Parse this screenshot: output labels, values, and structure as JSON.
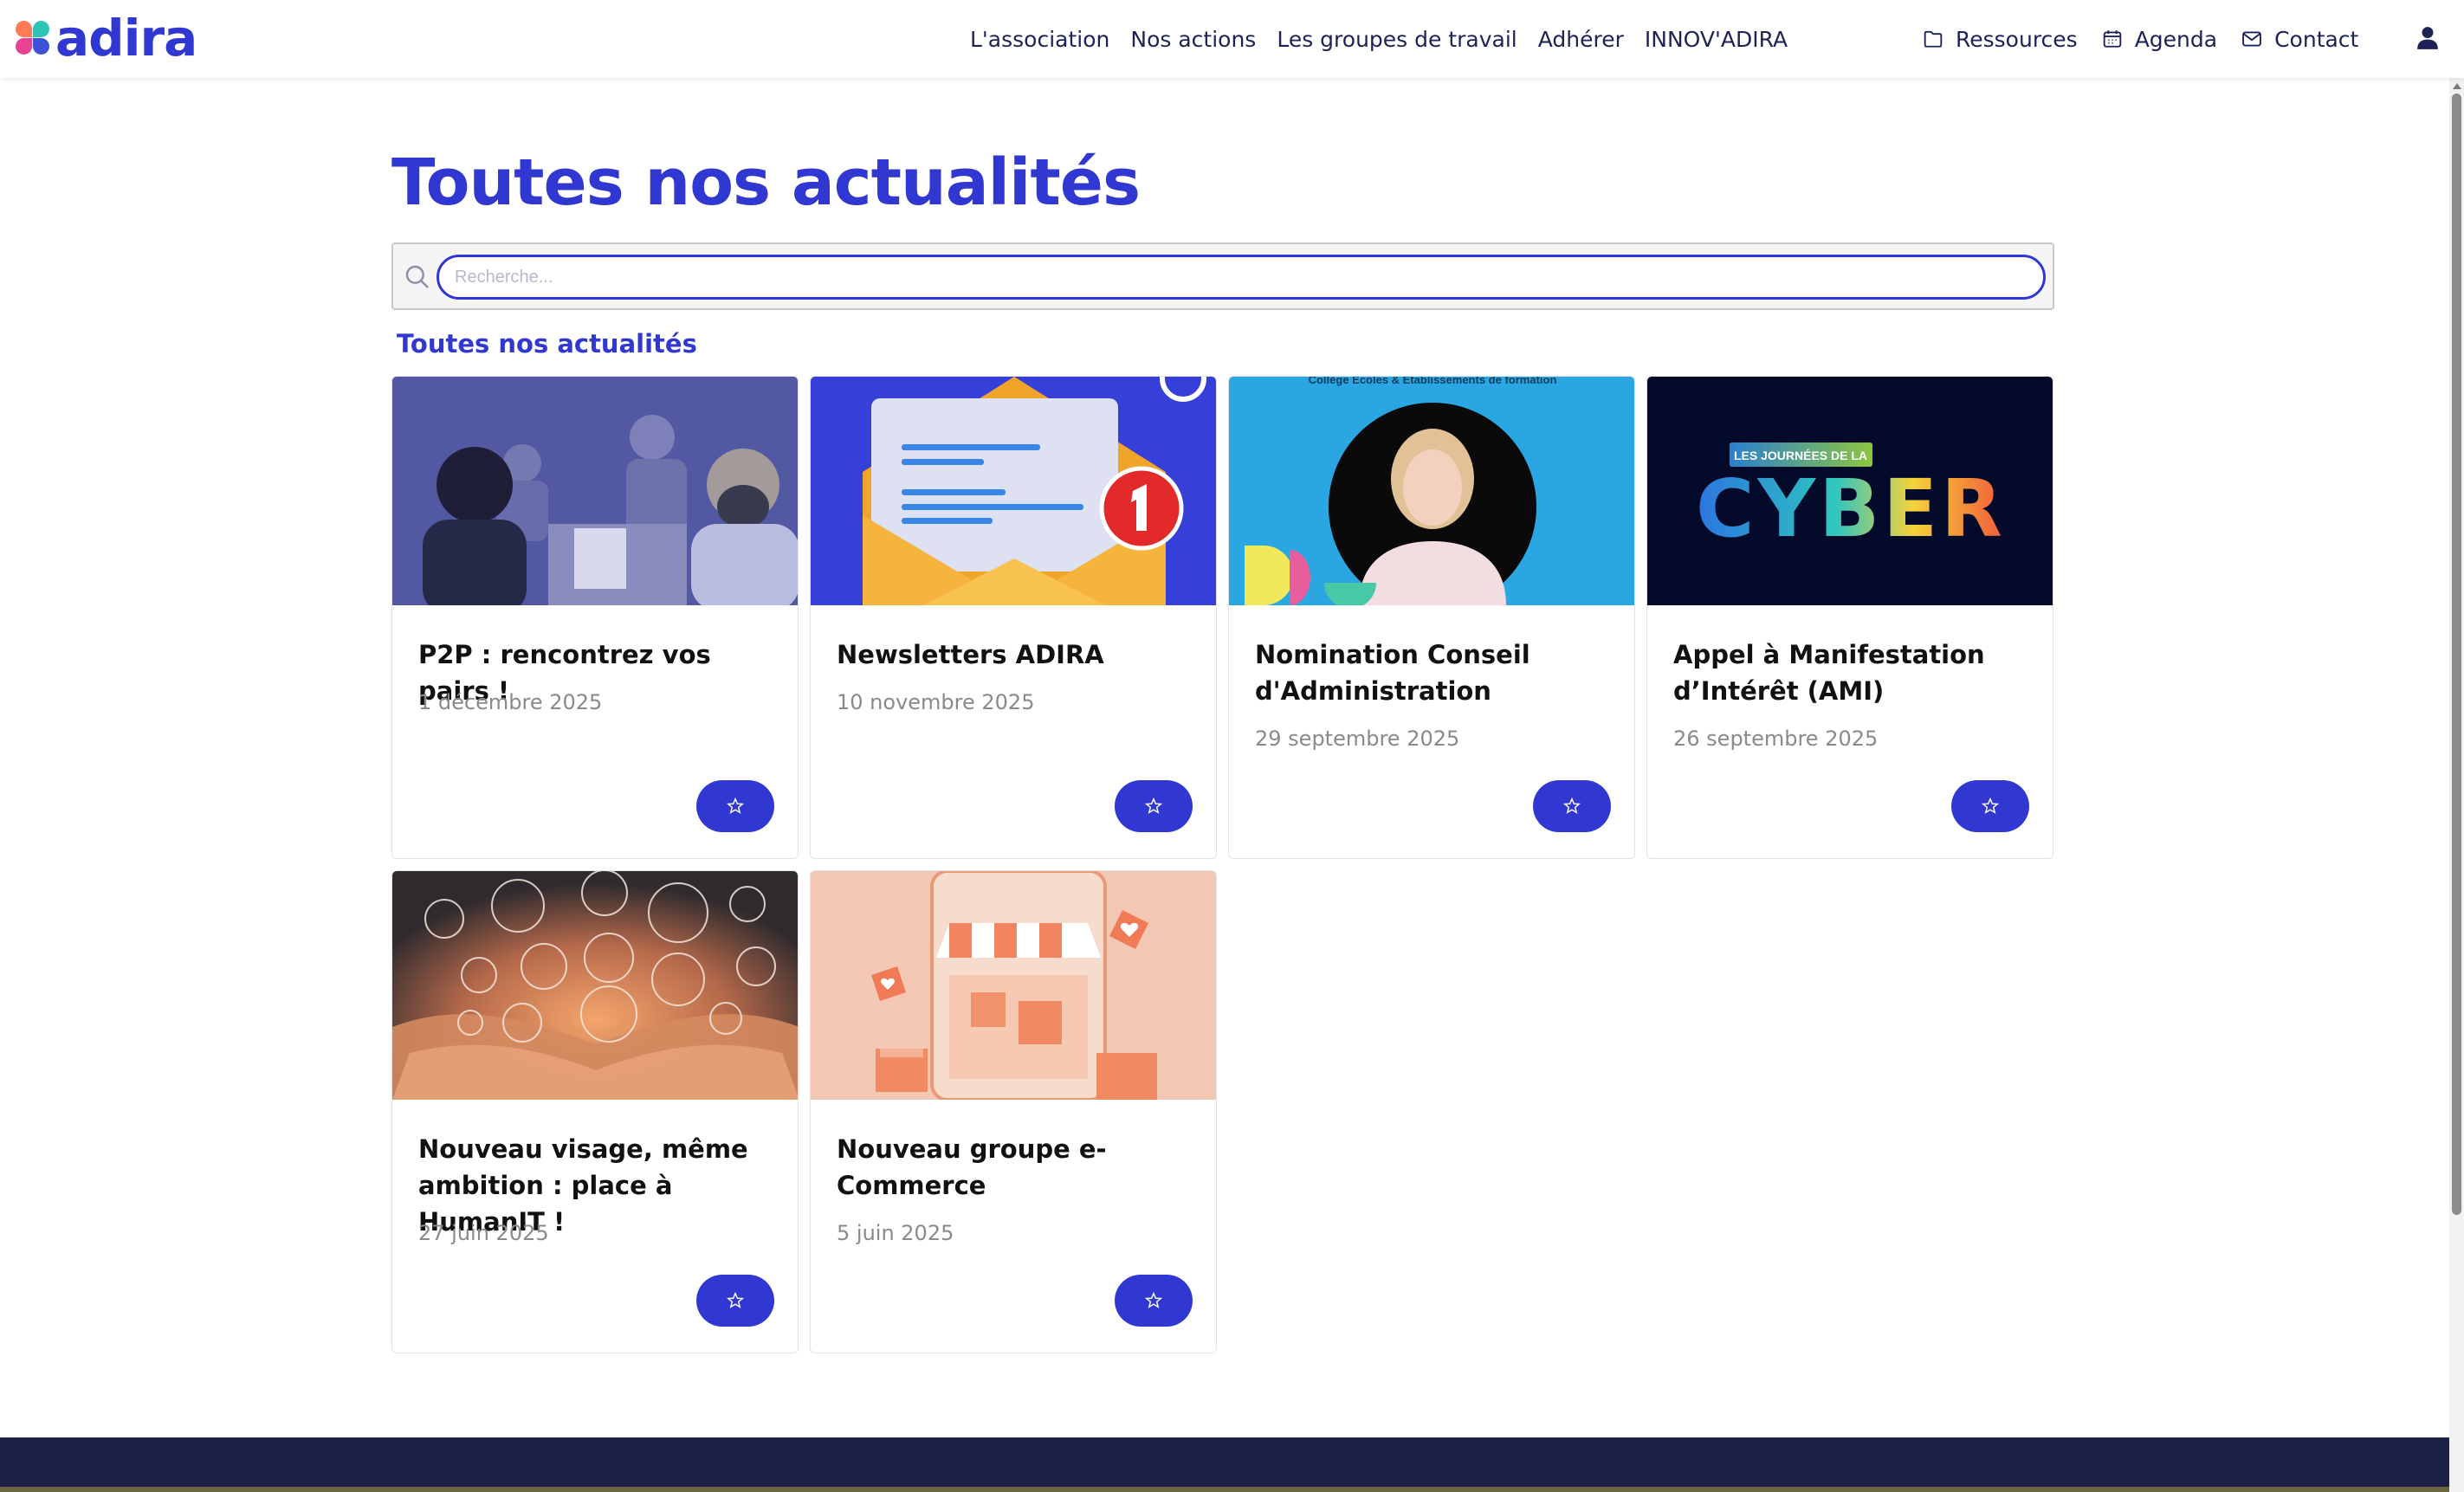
{
  "brand": {
    "name": "adira",
    "color": "#3137d1"
  },
  "nav": {
    "main": [
      "L'association",
      "Nos actions",
      "Les groupes de travail",
      "Adhérer",
      "INNOV'ADIRA"
    ],
    "ressources": "Ressources",
    "agenda": "Agenda",
    "contact": "Contact"
  },
  "page": {
    "title": "Toutes nos actualités",
    "section_label": "Toutes nos actualités"
  },
  "search": {
    "placeholder": "Recherche..."
  },
  "cards": [
    {
      "title": "P2P : rencontrez vos pairs !",
      "date": "1 décembre 2025"
    },
    {
      "title": "Newsletters ADIRA",
      "date": "10 novembre 2025"
    },
    {
      "title": "Nomination Conseil d'Administration",
      "date": "29 septembre 2025",
      "image_caption": "Collège Écoles & Établissements de formation"
    },
    {
      "title": "Appel à Manifestation d’Intérêt (AMI)",
      "date": "26 septembre 2025",
      "image_tag": "LES JOURNÉES DE LA",
      "image_word": "CYBER"
    },
    {
      "title": "Nouveau visage, même ambition : place à HumanIT !",
      "date": "27 juin 2025"
    },
    {
      "title": "Nouveau groupe e-Commerce",
      "date": "5 juin 2025"
    }
  ],
  "icons": {
    "favorite": "star-icon",
    "search": "search-icon",
    "user": "user-icon",
    "ressources": "folder-icon",
    "agenda": "calendar-icon",
    "contact": "mail-icon"
  }
}
